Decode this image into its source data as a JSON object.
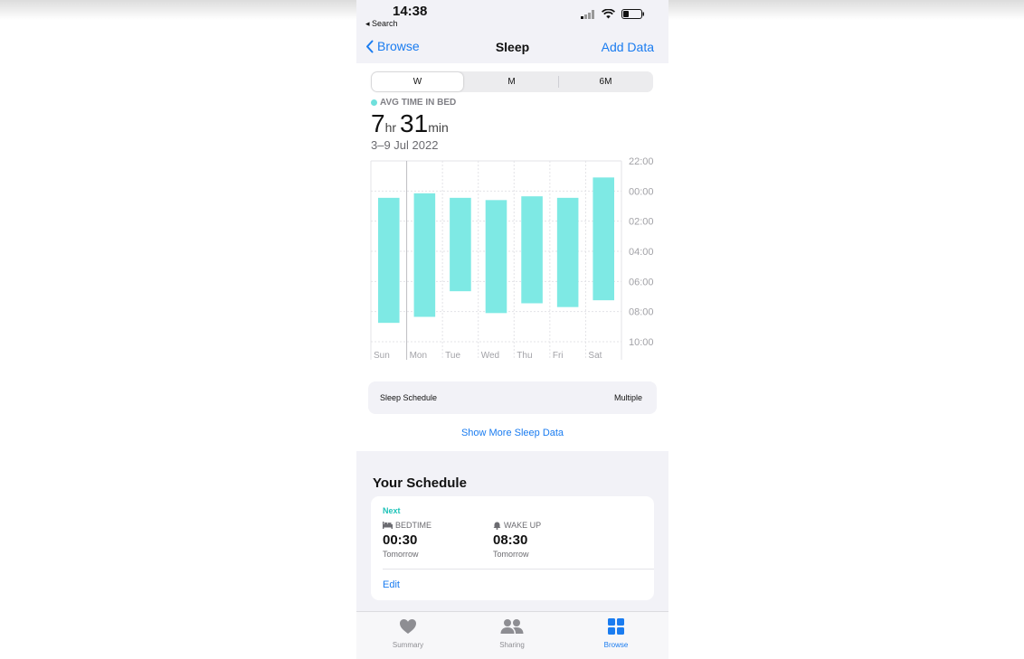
{
  "status": {
    "time": "14:38",
    "back_label": "◂ Search"
  },
  "nav": {
    "back_label": "Browse",
    "title": "Sleep",
    "action_label": "Add Data"
  },
  "segments": [
    {
      "label": "W",
      "active": true
    },
    {
      "label": "M",
      "active": false
    },
    {
      "label": "6M",
      "active": false
    }
  ],
  "summary": {
    "label": "AVG TIME IN BED",
    "hours": "7",
    "hours_unit": "hr",
    "minutes": "31",
    "minutes_unit": "min",
    "date_range": "3–9 Jul 2022"
  },
  "chart_data": {
    "type": "bar",
    "categories": [
      "Sun",
      "Mon",
      "Tue",
      "Wed",
      "Thu",
      "Fri",
      "Sat"
    ],
    "series": [
      {
        "start": [
          0.45,
          0.15,
          0.45,
          0.6,
          0.35,
          0.45,
          -0.9
        ],
        "end": [
          8.75,
          8.35,
          6.65,
          8.1,
          7.45,
          7.7,
          7.25
        ]
      }
    ],
    "y_ticks": [
      "22:00",
      "00:00",
      "02:00",
      "04:00",
      "06:00",
      "08:00",
      "10:00"
    ],
    "y_range": [
      -2,
      10
    ],
    "bar_color": "#7ee9e4",
    "grid": true
  },
  "schedule_card": {
    "label": "Sleep Schedule",
    "value": "Multiple"
  },
  "show_more": "Show More Sleep Data",
  "your_schedule": {
    "title": "Your Schedule",
    "next_label": "Next",
    "bedtime": {
      "label": "BEDTIME",
      "time": "00:30",
      "day": "Tomorrow"
    },
    "wake": {
      "label": "WAKE UP",
      "time": "08:30",
      "day": "Tomorrow"
    },
    "edit_label": "Edit"
  },
  "tabs": [
    {
      "label": "Summary",
      "icon": "heart-icon",
      "active": false
    },
    {
      "label": "Sharing",
      "icon": "people-icon",
      "active": false
    },
    {
      "label": "Browse",
      "icon": "grid-icon",
      "active": true
    }
  ],
  "colors": {
    "accent": "#1a7cf0",
    "bar": "#7ee9e4",
    "next": "#1ec3b8"
  }
}
